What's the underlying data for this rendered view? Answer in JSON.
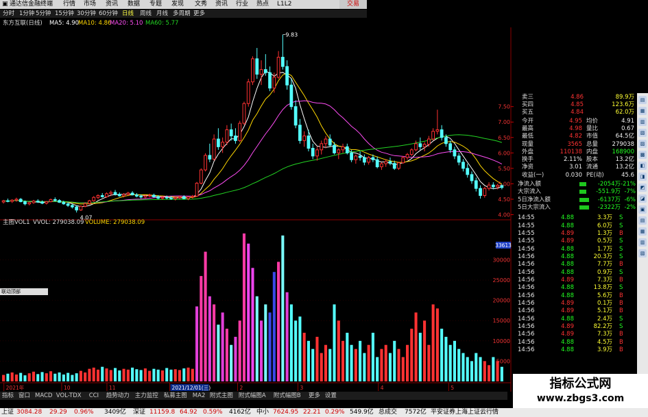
{
  "titlebar": {
    "app_name": "通达信金融终端",
    "menus": [
      "行情",
      "市场",
      "资讯",
      "数据",
      "专题",
      "发现",
      "文秀",
      "资讯",
      "行业",
      "热点",
      "L1L2"
    ],
    "right": "交易"
  },
  "periods": [
    "分时",
    "1分钟",
    "5分钟",
    "15分钟",
    "30分钟",
    "60分钟",
    "日线",
    "周线",
    "月线",
    "多周期",
    "更多"
  ],
  "active_period": "日线",
  "indicators": {
    "stock": "东方互联(日线)",
    "ma5": "MA5: 4.90",
    "ma10": "MA10: 4.86",
    "ma20": "MA20: 5.10",
    "ma60": "MA60: 5.77",
    "high_label": "9.83",
    "low_label": "4.07"
  },
  "volume_bar": {
    "name": "主图VOL1",
    "vvol": "VVOL: 279038.09",
    "volume": "VOLUME: 279038.09"
  },
  "volume_cursor": "33613",
  "mini_toolbar": "联动顶部",
  "date_axis": [
    "2021年",
    "10",
    "11",
    "2021/12/01(三)",
    "2",
    "3",
    "4",
    "5"
  ],
  "tabs": [
    "指标",
    "窗口",
    "MACD",
    "VOL-TDX",
    "CCI",
    "趋势动力",
    "主力监控",
    "私募主图",
    "MA2",
    "附式主图",
    "附式幅图A",
    "附式幅图B",
    "更多",
    "设置"
  ],
  "status": {
    "sh_label": "上证",
    "sh_value": "3084.28",
    "sh_chg": "29.29",
    "sh_pct": "0.96%",
    "sh_amt": "3409亿",
    "sz_label": "深证",
    "sz_value": "11159.8",
    "sz_chg": "64.92",
    "sz_pct": "0.59%",
    "sz_amt": "4162亿",
    "zx_label": "中小",
    "zx_value": "7624.95",
    "zx_chg": "22.21",
    "zx_pct": "0.29%",
    "zx_amt": "549.9亿",
    "total_label": "总成交",
    "total_value": "7572亿",
    "broker": "平安证券上海上证云行情"
  },
  "price_axis": [
    "7.50",
    "7.00",
    "6.50",
    "6.00",
    "5.50",
    "5.00",
    "4.50",
    "4.00"
  ],
  "vol_axis": [
    "30000",
    "25000",
    "20000",
    "15000",
    "10000",
    "5000"
  ],
  "quote": {
    "sell3": {
      "label": "卖三",
      "price": "4.86",
      "vol": "89.9万"
    },
    "sell4": {
      "label": "买四",
      "price": "4.85",
      "vol": "123.6万"
    },
    "sell5": {
      "label": "买五",
      "price": "4.84",
      "vol": "62.0万"
    },
    "rows": [
      {
        "l1": "今开",
        "v1": "4.95",
        "l2": "均价",
        "v2": "4.91"
      },
      {
        "l1": "最高",
        "v1": "4.98",
        "l2": "量比",
        "v2": "0.67"
      },
      {
        "l1": "最低",
        "v1": "4.82",
        "l2": "市值",
        "v2": "64.5亿"
      },
      {
        "l1": "现量",
        "v1": "3565",
        "l2": "总量",
        "v2": "279038"
      },
      {
        "l1": "外盘",
        "v1": "110138",
        "l2": "内盘",
        "v2": "168900"
      },
      {
        "l1": "换手",
        "v1": "2.11%",
        "l2": "股本",
        "v2": "13.2亿"
      },
      {
        "l1": "净资",
        "v1": "3.01",
        "l2": "流通",
        "v2": "13.2亿"
      },
      {
        "l1": "收益(一)",
        "v1": "0.030",
        "l2": "PE(动)",
        "v2": "45.6"
      }
    ],
    "flows": [
      {
        "label": "净流入额",
        "value": "-2054万",
        "pct": "-21%"
      },
      {
        "label": "大宗流入",
        "value": "-551.9万",
        "pct": "-7%"
      },
      {
        "label": "5日净流入额",
        "value": "-6137万",
        "pct": "-6%"
      },
      {
        "label": "5日大宗流入",
        "value": "-2322万",
        "pct": "-2%"
      }
    ]
  },
  "ticks": [
    {
      "t": "14:55",
      "p": "4.88",
      "v": "3.3万",
      "s": "S"
    },
    {
      "t": "14:55",
      "p": "4.88",
      "v": "6.0万",
      "s": "S"
    },
    {
      "t": "14:55",
      "p": "4.89",
      "v": "1.3万",
      "s": "B"
    },
    {
      "t": "14:55",
      "p": "4.89",
      "v": "0.5万",
      "s": "S"
    },
    {
      "t": "14:56",
      "p": "4.88",
      "v": "1.7万",
      "s": "S"
    },
    {
      "t": "14:56",
      "p": "4.88",
      "v": "20.3万",
      "s": "S"
    },
    {
      "t": "14:56",
      "p": "4.88",
      "v": "7.7万",
      "s": "B"
    },
    {
      "t": "14:56",
      "p": "4.88",
      "v": "0.9万",
      "s": "S"
    },
    {
      "t": "14:56",
      "p": "4.89",
      "v": "7.3万",
      "s": "B"
    },
    {
      "t": "14:56",
      "p": "4.88",
      "v": "13.8万",
      "s": "S"
    },
    {
      "t": "14:56",
      "p": "4.88",
      "v": "5.6万",
      "s": "B"
    },
    {
      "t": "14:56",
      "p": "4.89",
      "v": "0.1万",
      "s": "B"
    },
    {
      "t": "14:56",
      "p": "4.89",
      "v": "5.1万",
      "s": "B"
    },
    {
      "t": "14:56",
      "p": "4.88",
      "v": "2.4万",
      "s": "S"
    },
    {
      "t": "14:56",
      "p": "4.89",
      "v": "82.2万",
      "s": "S"
    },
    {
      "t": "14:56",
      "p": "4.89",
      "v": "7.3万",
      "s": "B"
    },
    {
      "t": "14:56",
      "p": "4.88",
      "v": "4.5万",
      "s": "B"
    },
    {
      "t": "14:56",
      "p": "4.88",
      "v": "3.9万",
      "s": "B"
    }
  ],
  "watermark": {
    "line1": "指标公式网",
    "line2": "www.zbgs3.com"
  },
  "chart_data": {
    "type": "candlestick",
    "price_range": [
      3.9,
      10.0
    ],
    "candles": [
      [
        4.41,
        4.48,
        4.36,
        4.45
      ],
      [
        4.45,
        4.52,
        4.4,
        4.43
      ],
      [
        4.43,
        4.5,
        4.38,
        4.47
      ],
      [
        4.47,
        4.55,
        4.42,
        4.5
      ],
      [
        4.5,
        4.54,
        4.4,
        4.42
      ],
      [
        4.42,
        4.46,
        4.3,
        4.35
      ],
      [
        4.35,
        4.42,
        4.3,
        4.39
      ],
      [
        4.39,
        4.48,
        4.35,
        4.44
      ],
      [
        4.44,
        4.5,
        4.38,
        4.41
      ],
      [
        4.41,
        4.46,
        4.34,
        4.37
      ],
      [
        4.37,
        4.44,
        4.33,
        4.42
      ],
      [
        4.42,
        4.52,
        4.4,
        4.49
      ],
      [
        4.49,
        4.56,
        4.43,
        4.46
      ],
      [
        4.46,
        4.5,
        4.38,
        4.4
      ],
      [
        4.4,
        4.45,
        4.32,
        4.35
      ],
      [
        4.35,
        4.4,
        4.25,
        4.3
      ],
      [
        4.3,
        4.36,
        4.2,
        4.25
      ],
      [
        4.25,
        4.3,
        4.07,
        4.15
      ],
      [
        4.15,
        4.3,
        4.12,
        4.27
      ],
      [
        4.27,
        4.4,
        4.24,
        4.36
      ],
      [
        4.36,
        4.48,
        4.33,
        4.45
      ],
      [
        4.45,
        4.6,
        4.42,
        4.56
      ],
      [
        4.56,
        4.66,
        4.5,
        4.62
      ],
      [
        4.62,
        4.7,
        4.55,
        4.58
      ],
      [
        4.58,
        4.72,
        4.55,
        4.68
      ],
      [
        4.68,
        4.78,
        4.6,
        4.72
      ],
      [
        4.72,
        4.8,
        4.62,
        4.66
      ],
      [
        4.66,
        4.72,
        4.58,
        4.61
      ],
      [
        4.61,
        4.7,
        4.56,
        4.66
      ],
      [
        4.66,
        4.74,
        4.6,
        4.7
      ],
      [
        4.7,
        4.76,
        4.62,
        4.64
      ],
      [
        4.64,
        4.7,
        4.56,
        4.6
      ],
      [
        4.6,
        4.66,
        4.52,
        4.57
      ],
      [
        4.57,
        4.64,
        4.52,
        4.61
      ],
      [
        4.61,
        4.68,
        4.56,
        4.63
      ],
      [
        4.63,
        4.68,
        4.55,
        4.58
      ],
      [
        4.58,
        4.63,
        4.5,
        4.53
      ],
      [
        4.53,
        4.6,
        4.48,
        4.56
      ],
      [
        4.56,
        4.62,
        4.5,
        4.54
      ],
      [
        4.54,
        4.6,
        4.48,
        4.52
      ],
      [
        4.52,
        4.58,
        4.46,
        4.55
      ],
      [
        4.55,
        4.62,
        4.5,
        4.58
      ],
      [
        4.58,
        4.63,
        4.5,
        4.52
      ],
      [
        4.52,
        4.6,
        4.47,
        4.57
      ],
      [
        4.57,
        4.64,
        4.52,
        4.6
      ],
      [
        4.6,
        5.06,
        4.58,
        5.02
      ],
      [
        5.02,
        5.5,
        4.98,
        5.45
      ],
      [
        5.45,
        5.99,
        5.4,
        5.92
      ],
      [
        5.92,
        6.3,
        5.7,
        5.8
      ],
      [
        5.8,
        6.6,
        5.75,
        6.45
      ],
      [
        6.45,
        6.8,
        6.1,
        6.2
      ],
      [
        6.2,
        6.5,
        6.0,
        6.35
      ],
      [
        6.35,
        6.9,
        6.25,
        6.75
      ],
      [
        6.75,
        6.95,
        6.4,
        6.55
      ],
      [
        6.55,
        6.8,
        6.3,
        6.4
      ],
      [
        6.4,
        7.04,
        6.35,
        6.96
      ],
      [
        6.96,
        7.66,
        6.9,
        7.6
      ],
      [
        7.6,
        8.4,
        7.5,
        8.3
      ],
      [
        8.3,
        9.13,
        8.2,
        9.05
      ],
      [
        9.05,
        9.4,
        8.4,
        8.55
      ],
      [
        8.55,
        9.0,
        8.2,
        8.7
      ],
      [
        8.7,
        9.2,
        8.5,
        8.6
      ],
      [
        8.6,
        8.8,
        8.0,
        8.1
      ],
      [
        8.1,
        8.6,
        7.95,
        8.45
      ],
      [
        8.45,
        9.3,
        8.4,
        9.1
      ],
      [
        9.1,
        9.83,
        8.7,
        8.8
      ],
      [
        8.8,
        9.0,
        8.05,
        8.2
      ],
      [
        8.2,
        8.4,
        7.4,
        7.5
      ],
      [
        7.5,
        7.7,
        6.8,
        6.9
      ],
      [
        6.9,
        7.1,
        6.3,
        6.4
      ],
      [
        6.4,
        6.7,
        6.2,
        6.55
      ],
      [
        6.55,
        6.75,
        6.05,
        6.15
      ],
      [
        6.15,
        6.3,
        5.8,
        5.9
      ],
      [
        5.9,
        6.2,
        5.75,
        6.1
      ],
      [
        6.1,
        6.4,
        5.95,
        6.3
      ],
      [
        6.3,
        6.55,
        6.15,
        6.45
      ],
      [
        6.45,
        6.6,
        6.2,
        6.25
      ],
      [
        6.25,
        6.35,
        5.95,
        6.0
      ],
      [
        6.0,
        6.15,
        5.8,
        6.1
      ],
      [
        6.1,
        6.3,
        6.0,
        6.2
      ],
      [
        6.2,
        6.3,
        5.95,
        6.0
      ],
      [
        6.0,
        6.1,
        5.7,
        5.78
      ],
      [
        5.78,
        5.95,
        5.65,
        5.9
      ],
      [
        5.9,
        6.05,
        5.75,
        5.85
      ],
      [
        5.85,
        5.95,
        5.6,
        5.7
      ],
      [
        5.7,
        5.9,
        5.62,
        5.85
      ],
      [
        5.85,
        5.95,
        5.7,
        5.78
      ],
      [
        5.78,
        5.88,
        5.5,
        5.55
      ],
      [
        5.55,
        5.7,
        5.45,
        5.65
      ],
      [
        5.65,
        5.8,
        5.55,
        5.72
      ],
      [
        5.72,
        5.85,
        5.6,
        5.66
      ],
      [
        5.66,
        5.75,
        5.45,
        5.5
      ],
      [
        5.5,
        5.7,
        5.45,
        5.68
      ],
      [
        5.68,
        5.9,
        5.65,
        5.85
      ],
      [
        5.85,
        6.0,
        5.78,
        5.95
      ],
      [
        5.95,
        6.15,
        5.9,
        6.1
      ],
      [
        6.1,
        6.4,
        6.05,
        6.3
      ],
      [
        6.3,
        6.5,
        6.1,
        6.2
      ],
      [
        6.2,
        6.35,
        6.05,
        6.28
      ],
      [
        6.28,
        6.55,
        6.2,
        6.45
      ],
      [
        6.45,
        6.8,
        6.4,
        6.7
      ],
      [
        6.7,
        7.4,
        6.6,
        6.75
      ],
      [
        6.75,
        6.9,
        6.4,
        6.5
      ],
      [
        6.5,
        6.6,
        6.2,
        6.3
      ],
      [
        6.3,
        6.4,
        6.0,
        6.1
      ],
      [
        6.1,
        6.2,
        5.8,
        5.9
      ],
      [
        5.9,
        6.0,
        5.6,
        5.7
      ],
      [
        5.7,
        5.8,
        5.4,
        5.5
      ],
      [
        5.5,
        5.65,
        5.2,
        5.3
      ],
      [
        5.3,
        5.4,
        5.0,
        5.1
      ],
      [
        5.1,
        5.2,
        4.75,
        4.85
      ],
      [
        4.85,
        4.95,
        4.52,
        4.62
      ],
      [
        4.62,
        4.9,
        4.55,
        4.85
      ],
      [
        4.85,
        5.05,
        4.78,
        4.96
      ],
      [
        4.96,
        5.05,
        4.82,
        4.9
      ],
      [
        4.9,
        5.0,
        4.82,
        4.95
      ],
      [
        4.95,
        4.98,
        4.82,
        4.88
      ]
    ],
    "ma_lines": {
      "ma5_color": "#ffffff",
      "ma10_color": "#ffd700",
      "ma20_color": "#ff4df5",
      "ma60_color": "#23d523"
    },
    "volume": [
      1600,
      1900,
      2200,
      1700,
      2100,
      1500,
      2000,
      2400,
      1800,
      2300,
      2000,
      2500,
      1900,
      2200,
      1700,
      2100,
      1600,
      2000,
      2600,
      2200,
      3100,
      3400,
      2900,
      3600,
      3200,
      2800,
      3300,
      2700,
      3100,
      2900,
      3400,
      3000,
      2800,
      3200,
      2600,
      3100,
      2900,
      2700,
      3300,
      2900,
      3000,
      2800,
      3200,
      3400,
      3100,
      18500,
      26000,
      32000,
      21000,
      19000,
      14000,
      17000,
      13000,
      9000,
      11000,
      15000,
      36500,
      34000,
      28000,
      21000,
      15000,
      19000,
      17000,
      27000,
      29500,
      36000,
      22000,
      19000,
      15000,
      16000,
      12000,
      10000,
      8000,
      11000,
      7000,
      9000,
      8000,
      19000,
      15000,
      10000,
      12000,
      9000,
      8000,
      10000,
      7000,
      9000,
      12000,
      6000,
      8000,
      9000,
      7000,
      10000,
      8000,
      6000,
      9000,
      13000,
      17000,
      12000,
      15000,
      9000,
      19000,
      18000,
      13000,
      11000,
      9000,
      10000,
      8000,
      7000,
      6000,
      5000,
      7000,
      6000,
      5000,
      4000,
      6000,
      5000,
      3600
    ],
    "volume_range": [
      0,
      37000
    ]
  }
}
